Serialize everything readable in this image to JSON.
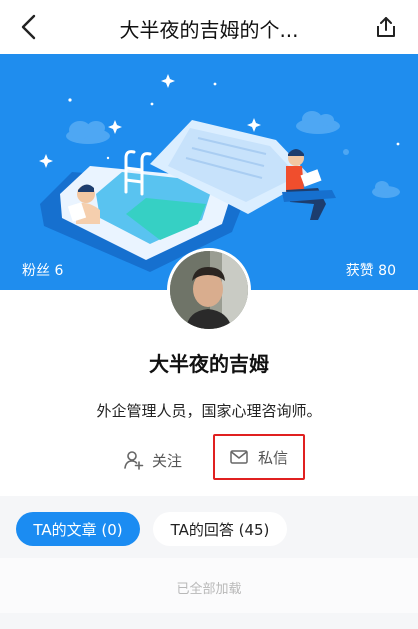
{
  "header": {
    "title": "大半夜的吉姆的个...",
    "back_icon": "chevron-left-icon",
    "share_icon": "share-icon"
  },
  "profile": {
    "fans_label": "粉丝 6",
    "likes_label": "获赞 80",
    "name": "大半夜的吉姆",
    "bio": "外企管理人员，国家心理咨询师。",
    "follow_label": "关注",
    "message_label": "私信"
  },
  "tabs": [
    {
      "label": "TA的文章 (0)"
    },
    {
      "label": "TA的回答 (45)"
    }
  ],
  "list": {
    "status": "已全部加载"
  },
  "colors": {
    "banner": "#1f8dee",
    "accent": "#1b8cf2",
    "highlight_border": "#e02020"
  }
}
